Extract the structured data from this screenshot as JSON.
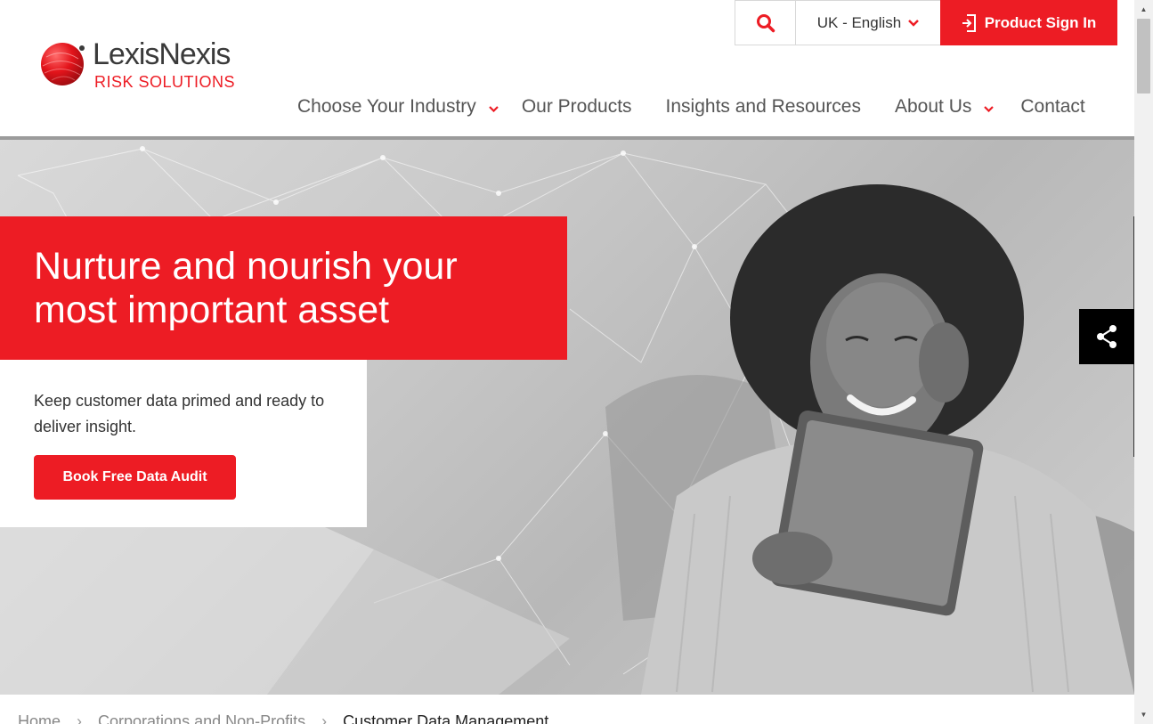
{
  "brand": {
    "name": "LexisNexis",
    "sub": "RISK SOLUTIONS",
    "accent": "#ed1c24"
  },
  "topbar": {
    "search_icon": "search-icon",
    "language": "UK - English",
    "signin_label": "Product Sign In",
    "signin_icon": "sign-in-icon"
  },
  "nav": {
    "items": [
      {
        "label": "Choose Your Industry",
        "has_dropdown": true
      },
      {
        "label": "Our Products",
        "has_dropdown": false
      },
      {
        "label": "Insights and Resources",
        "has_dropdown": false
      },
      {
        "label": "About Us",
        "has_dropdown": true
      },
      {
        "label": "Contact",
        "has_dropdown": false
      }
    ]
  },
  "hero": {
    "headline": "Nurture and nourish your most important asset",
    "body": "Keep customer data primed and ready to deliver insight.",
    "cta_label": "Book Free Data Audit"
  },
  "share": {
    "icon": "share-icon"
  },
  "breadcrumb": {
    "items": [
      "Home",
      "Corporations and Non-Profits",
      "Customer Data Management"
    ],
    "separator": "›"
  }
}
